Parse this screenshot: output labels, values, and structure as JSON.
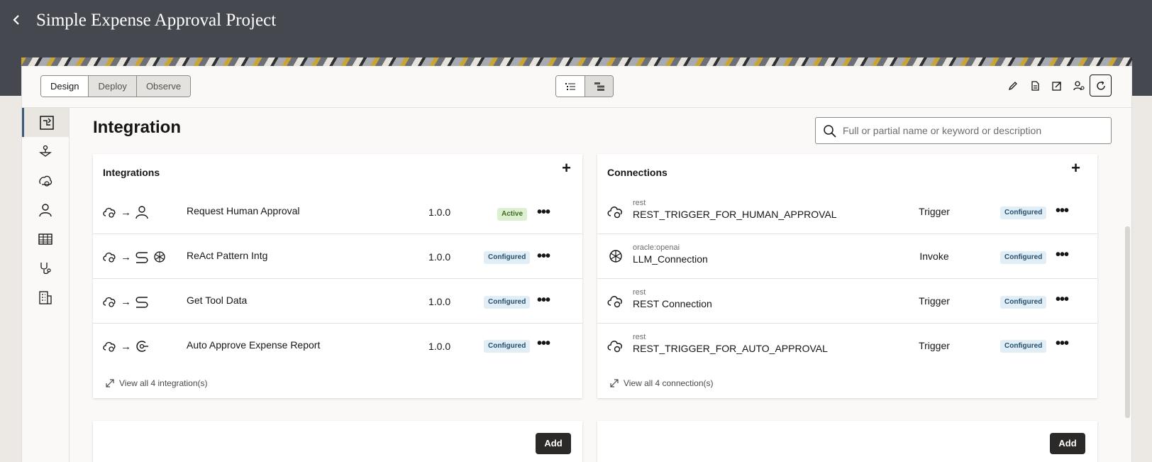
{
  "header": {
    "back_icon": "chevron-left-icon",
    "title": "Simple Expense Approval Project"
  },
  "tabs": [
    {
      "label": "Design"
    },
    {
      "label": "Deploy"
    },
    {
      "label": "Observe"
    }
  ],
  "view_toggle": [
    "list-view-icon",
    "diagram-view-icon"
  ],
  "tools": [
    "edit-icon",
    "document-icon",
    "export-icon",
    "share-icon",
    "refresh-icon"
  ],
  "leftnav": [
    "integration-icon",
    "process-icon",
    "decision-icon",
    "user-icon",
    "table-icon",
    "healthcare-icon",
    "building-icon"
  ],
  "page": {
    "title": "Integration",
    "search_placeholder": "Full or partial name or keyword or description"
  },
  "integrations": {
    "title": "Integrations",
    "add_label": "+",
    "rows": [
      {
        "name": "Request Human Approval",
        "version": "1.0.0",
        "status": "Active"
      },
      {
        "name": "ReAct Pattern Intg",
        "version": "1.0.0",
        "status": "Configured"
      },
      {
        "name": "Get Tool Data",
        "version": "1.0.0",
        "status": "Configured"
      },
      {
        "name": "Auto Approve Expense Report",
        "version": "1.0.0",
        "status": "Configured"
      }
    ],
    "arrow": "→",
    "more_label": "•••",
    "view_all": "View all 4 integration(s)"
  },
  "connections": {
    "title": "Connections",
    "add_label": "+",
    "rows": [
      {
        "type": "rest",
        "name": "REST_TRIGGER_FOR_HUMAN_APPROVAL",
        "role": "Trigger",
        "status": "Configured"
      },
      {
        "type": "oracle:openai",
        "name": "LLM_Connection",
        "role": "Invoke",
        "status": "Configured"
      },
      {
        "type": "rest",
        "name": "REST Connection",
        "role": "Trigger",
        "status": "Configured"
      },
      {
        "type": "rest",
        "name": "REST_TRIGGER_FOR_AUTO_APPROVAL",
        "role": "Trigger",
        "status": "Configured"
      }
    ],
    "more_label": "•••",
    "view_all": "View all 4 connection(s)"
  },
  "bottom_panels": {
    "add_label": "Add"
  },
  "colors": {
    "header_bg": "#45494f",
    "active_badge": "#dcefd0",
    "configured_badge": "#e1eef6",
    "add_button": "#2b2a28"
  }
}
